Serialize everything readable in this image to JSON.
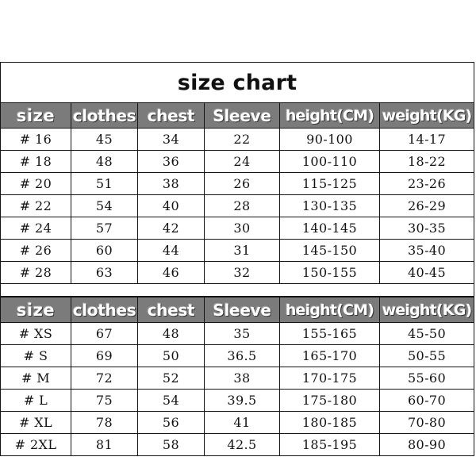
{
  "document": {
    "title": "size chart",
    "background_color": "#ffffff",
    "header_color": "#7b7b7b",
    "header_text_color": "#ffffff",
    "border_color": "#141414",
    "text_color": "#111111"
  },
  "columns": [
    "size",
    "clothes",
    "chest",
    "Sleeve",
    "height(CM)",
    "weight(KG)"
  ],
  "tables": [
    {
      "name": "youth-size-table",
      "headers": [
        "size",
        "clothes",
        "chest",
        "Sleeve",
        "height(CM)",
        "weight(KG)"
      ],
      "rows": [
        [
          "# 16",
          "45",
          "34",
          "22",
          "90-100",
          "14-17"
        ],
        [
          "# 18",
          "48",
          "36",
          "24",
          "100-110",
          "18-22"
        ],
        [
          "# 20",
          "51",
          "38",
          "26",
          "115-125",
          "23-26"
        ],
        [
          "# 22",
          "54",
          "40",
          "28",
          "130-135",
          "26-29"
        ],
        [
          "# 24",
          "57",
          "42",
          "30",
          "140-145",
          "30-35"
        ],
        [
          "# 26",
          "60",
          "44",
          "31",
          "145-150",
          "35-40"
        ],
        [
          "# 28",
          "63",
          "46",
          "32",
          "150-155",
          "40-45"
        ]
      ]
    },
    {
      "name": "adult-size-table",
      "headers": [
        "size",
        "clothes",
        "chest",
        "Sleeve",
        "height(CM)",
        "weight(KG)"
      ],
      "rows": [
        [
          "# XS",
          "67",
          "48",
          "35",
          "155-165",
          "45-50"
        ],
        [
          "# S",
          "69",
          "50",
          "36.5",
          "165-170",
          "50-55"
        ],
        [
          "# M",
          "72",
          "52",
          "38",
          "170-175",
          "55-60"
        ],
        [
          "# L",
          "75",
          "54",
          "39.5",
          "175-180",
          "60-70"
        ],
        [
          "# XL",
          "78",
          "56",
          "41",
          "180-185",
          "70-80"
        ],
        [
          "# 2XL",
          "81",
          "58",
          "42.5",
          "185-195",
          "80-90"
        ]
      ]
    }
  ]
}
